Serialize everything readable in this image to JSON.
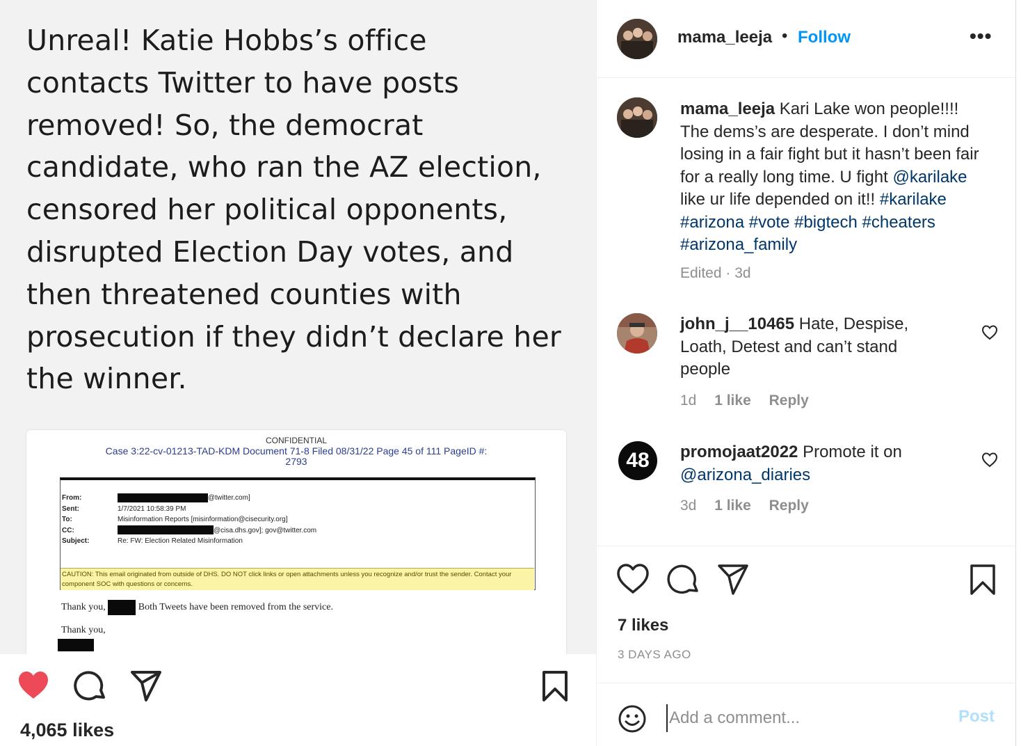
{
  "post": {
    "text_lines": [
      "Unreal!  Katie Hobbs’s office",
      "contacts Twitter to have posts",
      "removed!  So, the democrat",
      "candidate, who ran the AZ election,",
      "censored her political opponents,",
      "disrupted Election Day votes, and",
      "then threatened counties with",
      "prosecution if they didn’t declare her",
      "the winner."
    ],
    "document": {
      "confidential": "CONFIDENTIAL",
      "case_line1": "Case 3:22-cv-01213-TAD-KDM   Document 71-8   Filed 08/31/22   Page 45 of 111 PageID #:",
      "case_line2": "2793",
      "fields": [
        "From:",
        "Sent:",
        "To:",
        "CC:",
        "Subject:"
      ],
      "from_value": "@twitter.com]",
      "sent_value": "1/7/2021 10:58:39 PM",
      "to_value": "Misinformation Reports [misinformation@cisecurity.org]",
      "cc_value": "@cisa.dhs.gov]; gov@twitter.com",
      "subject_value": "Re: FW: Election Related Misinformation",
      "caution": "CAUTION: This email originated from outside of DHS. DO NOT click links or open attachments unless you recognize and/or trust the sender. Contact your component SOC with questions or concerns.",
      "thanks_prefix": "Thank you,",
      "thanks_suffix": "Both Tweets have been removed from the service.",
      "thanks2": "Thank you,"
    },
    "likes": "4,065 likes",
    "like_color": "#ed4956"
  },
  "header": {
    "username": "mama_leeja",
    "separator": "•",
    "follow_label": "Follow",
    "more_label": "•••",
    "accent": "#0095f6"
  },
  "comments": [
    {
      "username": "mama_leeja",
      "text": " Kari Lake won people!!!! The dems’s are desperate. I don’t mind losing in a fair fight but it hasn’t been fair for a really long time. U fight ",
      "mention": "@karilake",
      "text2": " like ur life depended on it!! ",
      "hashtags": "#karilake #arizona #vote #bigtech #cheaters #arizona_family",
      "meta": "Edited · 3d"
    },
    {
      "username": "john_j__10465",
      "text": " Hate, Despise, Loath, Detest and can’t stand people",
      "time": "1d",
      "likes": "1 like",
      "reply": "Reply"
    },
    {
      "username": "promojaat2022",
      "avatar_text": "48",
      "text": " Promote it on ",
      "mention": "@arizona_diaries",
      "time": "3d",
      "likes": "1 like",
      "reply": "Reply"
    }
  ],
  "actions": {
    "likes": "7 likes",
    "date": "3 DAYS AGO"
  },
  "add_comment": {
    "placeholder": "Add a comment...",
    "post_label": "Post"
  }
}
